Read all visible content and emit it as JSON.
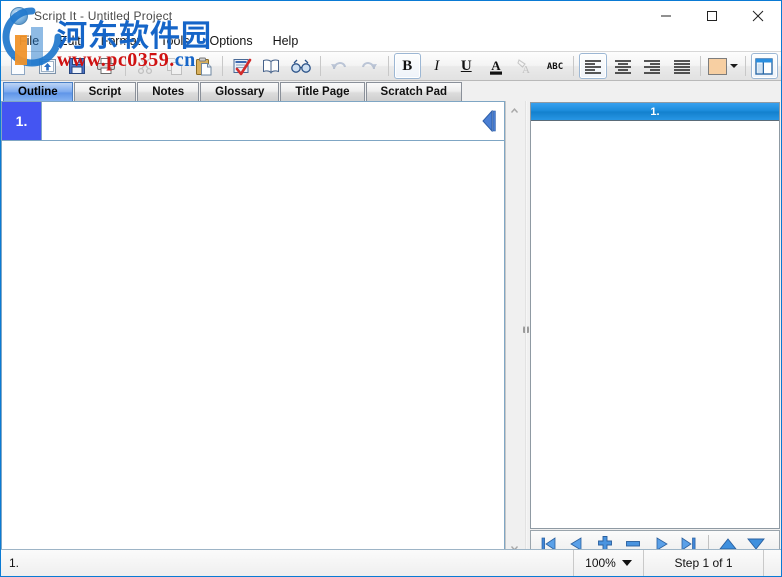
{
  "window": {
    "title": "Script It - Untitled Project",
    "icon": "app-globe-icon",
    "minimize_label": "Minimize",
    "maximize_label": "Maximize",
    "close_label": "Close"
  },
  "menu": {
    "items": [
      {
        "label": "File"
      },
      {
        "label": "Edit"
      },
      {
        "label": "Format"
      },
      {
        "label": "Tools"
      },
      {
        "label": "Options"
      },
      {
        "label": "Help"
      }
    ]
  },
  "toolbar": {
    "groups": [
      {
        "buttons": [
          {
            "name": "new-icon",
            "label": "New"
          },
          {
            "name": "open-icon",
            "label": "Open"
          },
          {
            "name": "save-icon",
            "label": "Save"
          },
          {
            "name": "print-icon",
            "label": "Print"
          }
        ]
      },
      {
        "buttons": [
          {
            "name": "cut-icon",
            "label": "Cut"
          },
          {
            "name": "copy-icon",
            "label": "Copy"
          },
          {
            "name": "paste-icon",
            "label": "Paste"
          }
        ]
      },
      {
        "buttons": [
          {
            "name": "spellcheck-icon",
            "label": "Spell Check"
          },
          {
            "name": "dictionary-icon",
            "label": "Dictionary"
          },
          {
            "name": "find-icon",
            "label": "Find"
          }
        ]
      },
      {
        "buttons": [
          {
            "name": "undo-icon",
            "label": "Undo"
          },
          {
            "name": "redo-icon",
            "label": "Redo"
          }
        ]
      },
      {
        "buttons": [
          {
            "name": "bold-icon",
            "label": "B"
          },
          {
            "name": "italic-icon",
            "label": "I"
          },
          {
            "name": "underline-icon",
            "label": "U"
          },
          {
            "name": "font-color-icon",
            "label": "A"
          },
          {
            "name": "highlight-icon",
            "label": "A"
          },
          {
            "name": "spelling-abc-icon",
            "label": "ABC"
          }
        ]
      },
      {
        "buttons": [
          {
            "name": "align-left-icon",
            "label": "Align Left"
          },
          {
            "name": "align-center-icon",
            "label": "Align Center"
          },
          {
            "name": "align-right-icon",
            "label": "Align Right"
          },
          {
            "name": "align-justify-icon",
            "label": "Justify"
          }
        ]
      },
      {
        "buttons": [
          {
            "name": "color-swatch",
            "label": "Color"
          },
          {
            "name": "panel-toggle-icon",
            "label": "Toggle Panel"
          }
        ]
      }
    ],
    "swatch_color": "#f7cfa2"
  },
  "tabs": [
    {
      "label": "Outline",
      "active": true
    },
    {
      "label": "Script",
      "active": false
    },
    {
      "label": "Notes",
      "active": false
    },
    {
      "label": "Glossary",
      "active": false
    },
    {
      "label": "Title Page",
      "active": false
    },
    {
      "label": "Scratch Pad",
      "active": false
    }
  ],
  "outline": {
    "cards": [
      {
        "number": "1.",
        "text": ""
      }
    ],
    "accent_color": "#4455f2"
  },
  "preview": {
    "header": "1.",
    "body": "",
    "header_color": "#1a8ad9"
  },
  "navigation": {
    "buttons": [
      {
        "name": "first-step-icon",
        "label": "First"
      },
      {
        "name": "previous-step-icon",
        "label": "Previous"
      },
      {
        "name": "add-step-icon",
        "label": "Add"
      },
      {
        "name": "remove-step-icon",
        "label": "Remove"
      },
      {
        "name": "next-step-icon",
        "label": "Next"
      },
      {
        "name": "last-step-icon",
        "label": "Last"
      },
      {
        "name": "move-up-icon",
        "label": "Move Up"
      },
      {
        "name": "move-down-icon",
        "label": "Move Down"
      }
    ]
  },
  "statusbar": {
    "left_text": "1.",
    "zoom": "100%",
    "step": "Step 1 of 1"
  },
  "watermark": {
    "chinese": "河东软件园",
    "url_red": "www.pc0359.",
    "url_blue": "cn"
  }
}
